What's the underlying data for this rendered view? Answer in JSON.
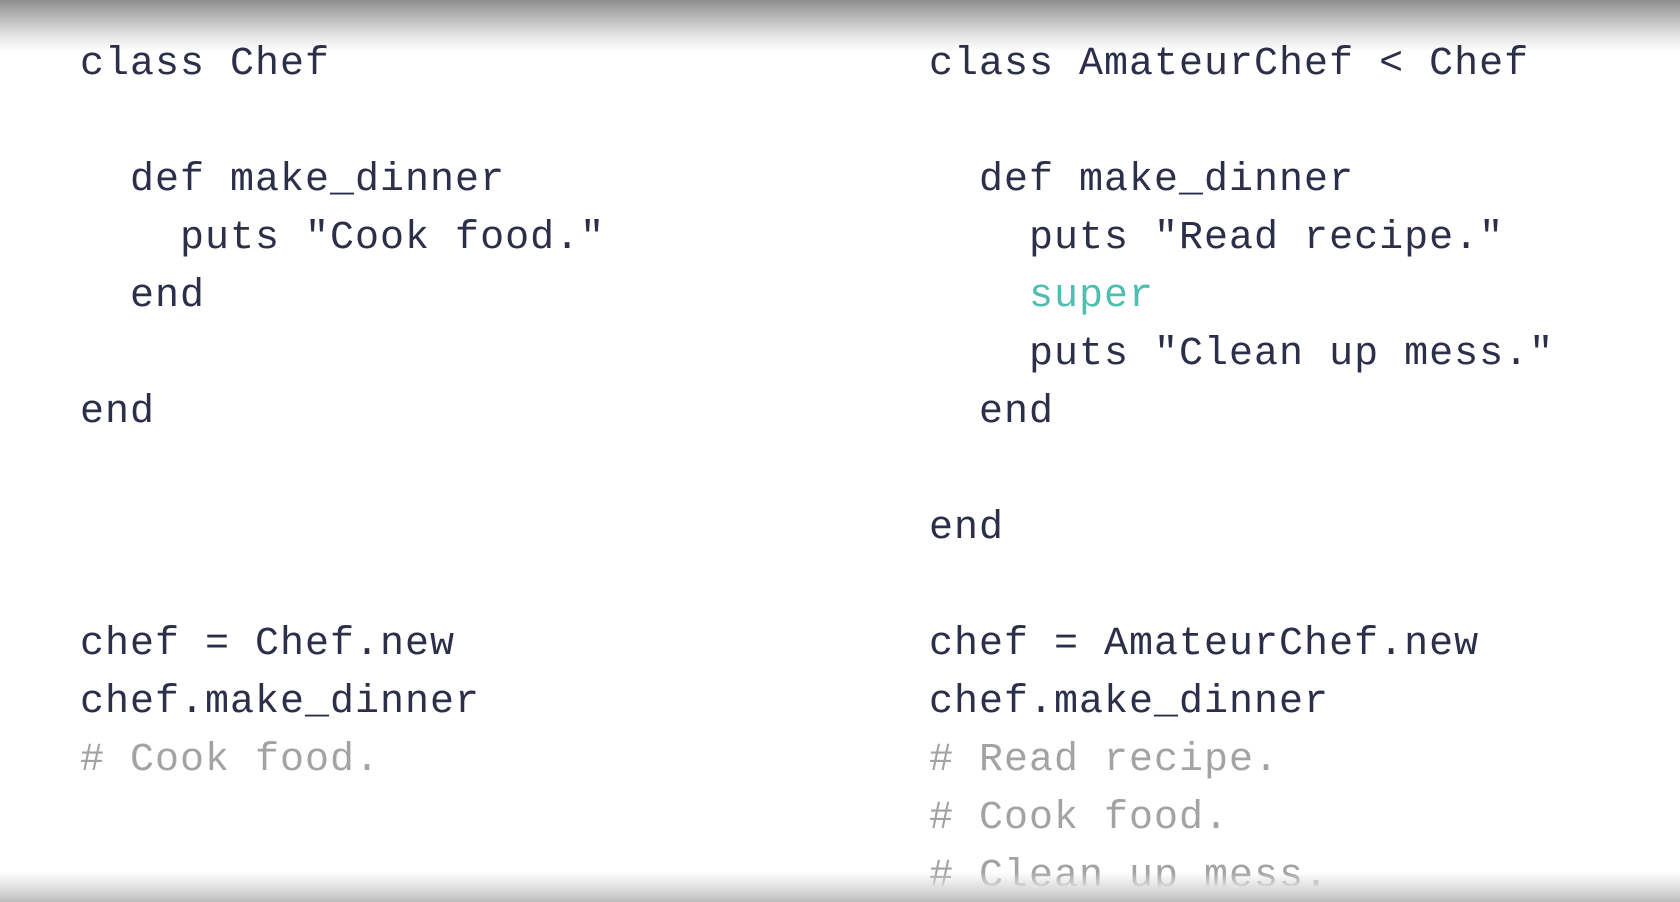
{
  "colors": {
    "code_text": "#2b2f4a",
    "comment_text": "#a3a3a3",
    "keyword_super": "#4fbdb0",
    "background": "#ffffff"
  },
  "left_panel": {
    "lines": [
      "class Chef",
      "",
      "  def make_dinner",
      "    puts \"Cook food.\"",
      "  end",
      "",
      "end",
      "",
      "",
      "",
      "chef = Chef.new",
      "chef.make_dinner",
      "# Cook food."
    ]
  },
  "right_panel": {
    "lines": [
      "class AmateurChef < Chef",
      "",
      "  def make_dinner",
      "    puts \"Read recipe.\"",
      "    super",
      "    puts \"Clean up mess.\"",
      "  end",
      "",
      "end",
      "",
      "chef = AmateurChef.new",
      "chef.make_dinner",
      "# Read recipe.",
      "# Cook food.",
      "# Clean up mess."
    ]
  }
}
